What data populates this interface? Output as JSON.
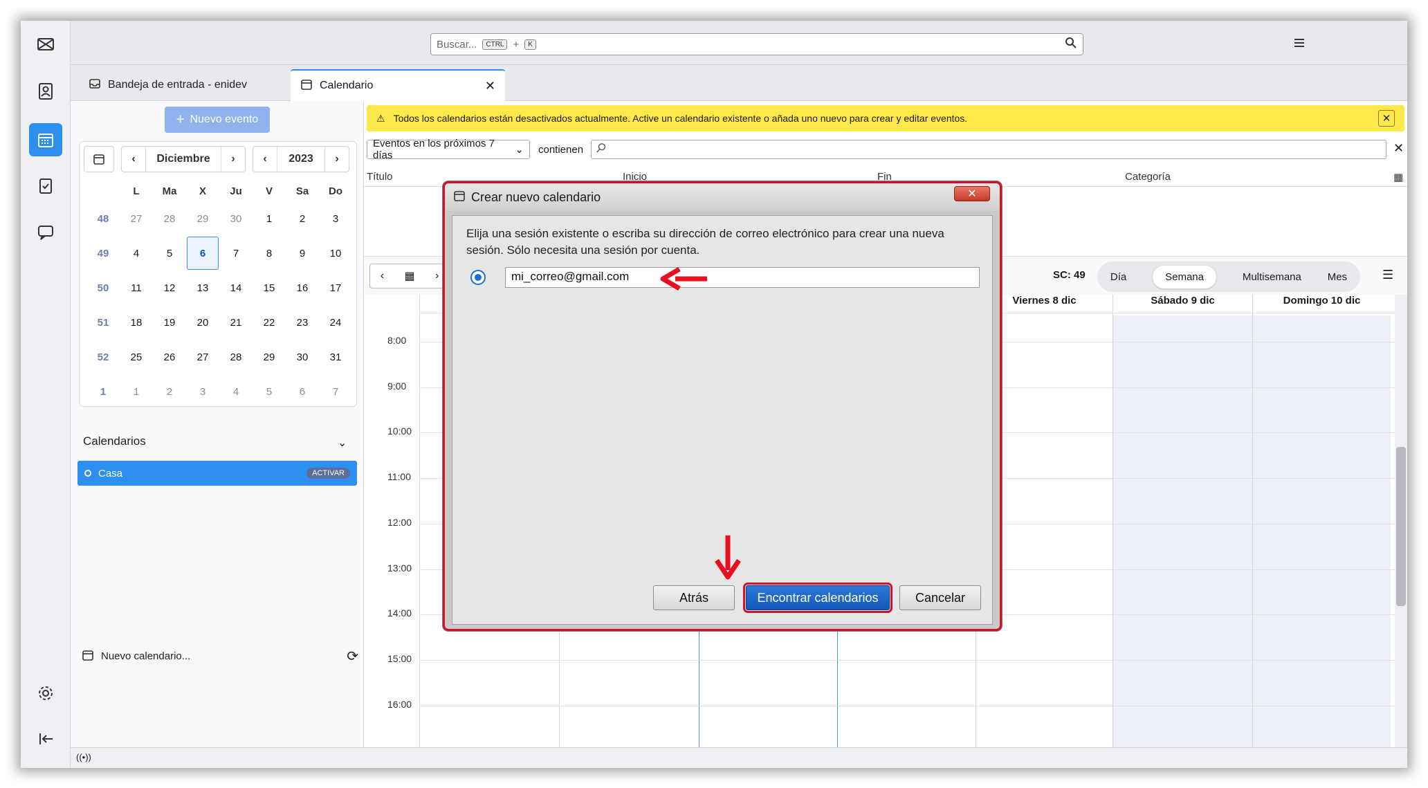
{
  "topbar": {
    "search_placeholder": "Buscar...",
    "kbd_ctrl": "CTRL",
    "kbd_plus": "+",
    "kbd_k": "K"
  },
  "tabs": [
    {
      "label": "Bandeja de entrada - enidev"
    },
    {
      "label": "Calendario"
    }
  ],
  "sidebar": {
    "new_event": "Nuevo evento",
    "month": "Diciembre",
    "year": "2023",
    "weekday_headers": [
      "L",
      "Ma",
      "X",
      "Ju",
      "V",
      "Sa",
      "Do"
    ],
    "weeks": [
      {
        "wk": "48",
        "days": [
          "27",
          "28",
          "29",
          "30",
          "1",
          "2",
          "3"
        ]
      },
      {
        "wk": "49",
        "days": [
          "4",
          "5",
          "6",
          "7",
          "8",
          "9",
          "10"
        ]
      },
      {
        "wk": "50",
        "days": [
          "11",
          "12",
          "13",
          "14",
          "15",
          "16",
          "17"
        ]
      },
      {
        "wk": "51",
        "days": [
          "18",
          "19",
          "20",
          "21",
          "22",
          "23",
          "24"
        ]
      },
      {
        "wk": "52",
        "days": [
          "25",
          "26",
          "27",
          "28",
          "29",
          "30",
          "31"
        ]
      },
      {
        "wk": "1",
        "days": [
          "1",
          "2",
          "3",
          "4",
          "5",
          "6",
          "7"
        ]
      }
    ],
    "calendars_header": "Calendarios",
    "calendar_item": "Casa",
    "calendar_badge": "ACTIVAR",
    "new_calendar": "Nuevo calendario..."
  },
  "main": {
    "warning": "Todos los calendarios están desactivados actualmente. Active un calendario existente o añada uno nuevo para crear y editar eventos.",
    "filter_select": "Eventos en los próximos 7 días",
    "contains": "contienen",
    "columns": [
      "Título",
      "Inicio",
      "Fin",
      "Categoría"
    ],
    "week_label": "SC: 49",
    "views": [
      "Día",
      "Semana",
      "Multisemana",
      "Mes"
    ],
    "day_headers": [
      "Viernes 8 dic",
      "Sábado 9 dic",
      "Domingo 10 dic"
    ],
    "hours": [
      "8:00",
      "9:00",
      "10:00",
      "11:00",
      "12:00",
      "13:00",
      "14:00",
      "15:00",
      "16:00"
    ]
  },
  "dialog": {
    "title": "Crear nuevo calendario",
    "close": "✕",
    "text": "Elija una sesión existente o escriba su dirección de correo electrónico para crear una nueva sesión. Sólo necesita una sesión por cuenta.",
    "email": "mi_correo@gmail.com",
    "back": "Atrás",
    "find": "Encontrar calendarios",
    "cancel": "Cancelar"
  },
  "colors": {
    "accent": "#2d8ff0",
    "warning": "#ffe94a",
    "highlight": "#d4102a"
  }
}
